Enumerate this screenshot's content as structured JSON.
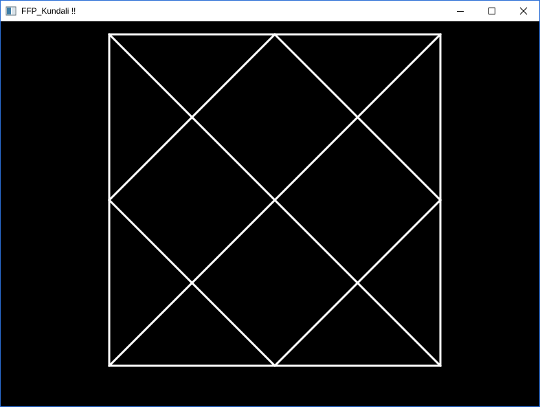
{
  "window": {
    "title": "FFP_Kundali !!",
    "controls": {
      "minimize_icon": "minimize-icon",
      "maximize_icon": "maximize-icon",
      "close_icon": "close-icon"
    }
  },
  "canvas": {
    "background_color": "#000000",
    "line_color": "#ffffff"
  }
}
